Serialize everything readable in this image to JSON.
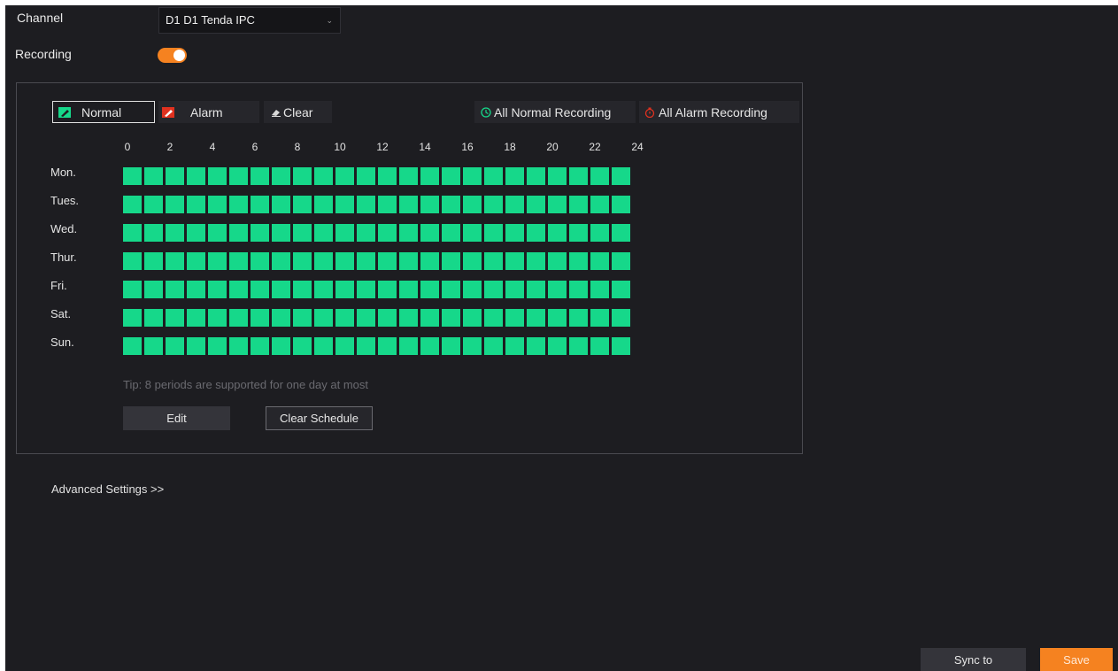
{
  "channel": {
    "label": "Channel",
    "value": "D1 D1 Tenda IPC"
  },
  "recording": {
    "label": "Recording",
    "enabled": true
  },
  "toolbar": {
    "normal_label": "Normal",
    "alarm_label": "Alarm",
    "clear_label": "Clear",
    "all_normal_label": "All Normal Recording",
    "all_alarm_label": "All Alarm Recording"
  },
  "schedule": {
    "hours": [
      "0",
      "2",
      "4",
      "6",
      "8",
      "10",
      "12",
      "14",
      "16",
      "18",
      "20",
      "22",
      "24"
    ],
    "days": [
      "Mon.",
      "Tues.",
      "Wed.",
      "Thur.",
      "Fri.",
      "Sat.",
      "Sun."
    ],
    "tip": "Tip: 8 periods are supported for one day at most",
    "normal_color": "#16d88a",
    "alarm_color": "#e0311f"
  },
  "buttons": {
    "edit": "Edit",
    "clear_schedule": "Clear Schedule",
    "sync_to": "Sync to",
    "save": "Save"
  },
  "advanced": {
    "label": "Advanced Settings >>"
  },
  "colors": {
    "accent": "#f58220",
    "background": "#1d1d21"
  }
}
